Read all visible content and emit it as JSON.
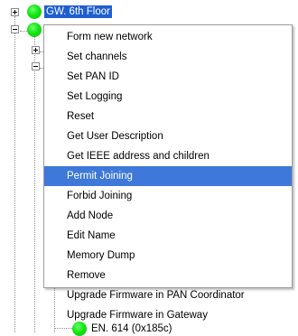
{
  "tree": {
    "root_label": "GW. 6th Floor",
    "bottom_label": "EN. 614 (0x185c)",
    "status_color": "#14e614",
    "selection_color": "#1f5fd1"
  },
  "context_menu": {
    "highlight_color": "#3e79d9",
    "highlighted_item": "Permit Joining",
    "items": [
      "Form new network",
      "Set channels",
      "Set PAN ID",
      "Set Logging",
      "Reset",
      "Get User Description",
      "Get IEEE address and children",
      "Permit Joining",
      "Forbid Joining",
      "Add Node",
      "Edit Name",
      "Memory Dump",
      "Remove",
      "Upgrade Firmware in PAN Coordinator",
      "Upgrade Firmware in Gateway"
    ]
  }
}
